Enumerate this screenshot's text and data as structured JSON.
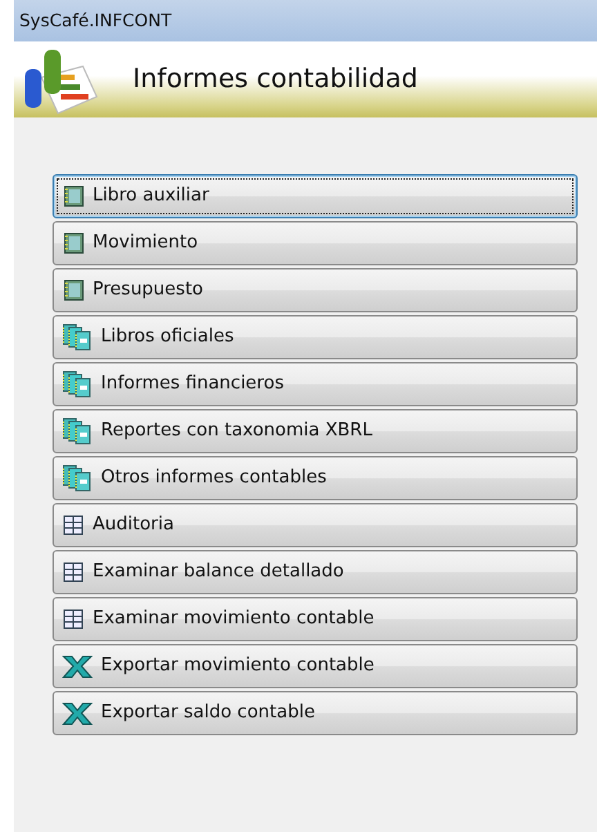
{
  "window": {
    "title": "SysCafé.INFCONT"
  },
  "header": {
    "title": "Informes contabilidad"
  },
  "buttons": [
    {
      "label": "Libro auxiliar",
      "kind": "ledger",
      "selected": true
    },
    {
      "label": "Movimiento",
      "kind": "ledger",
      "selected": false
    },
    {
      "label": "Presupuesto",
      "kind": "ledger",
      "selected": false
    },
    {
      "label": "Libros oficiales",
      "kind": "books",
      "selected": false
    },
    {
      "label": "Informes financieros",
      "kind": "books",
      "selected": false
    },
    {
      "label": "Reportes con taxonomia XBRL",
      "kind": "books",
      "selected": false
    },
    {
      "label": "Otros informes contables",
      "kind": "books",
      "selected": false
    },
    {
      "label": "Auditoria",
      "kind": "grid",
      "selected": false
    },
    {
      "label": "Examinar balance detallado",
      "kind": "grid",
      "selected": false
    },
    {
      "label": "Examinar movimiento contable",
      "kind": "grid",
      "selected": false
    },
    {
      "label": "Exportar movimiento contable",
      "kind": "excel",
      "selected": false
    },
    {
      "label": "Exportar saldo contable",
      "kind": "excel",
      "selected": false
    }
  ]
}
